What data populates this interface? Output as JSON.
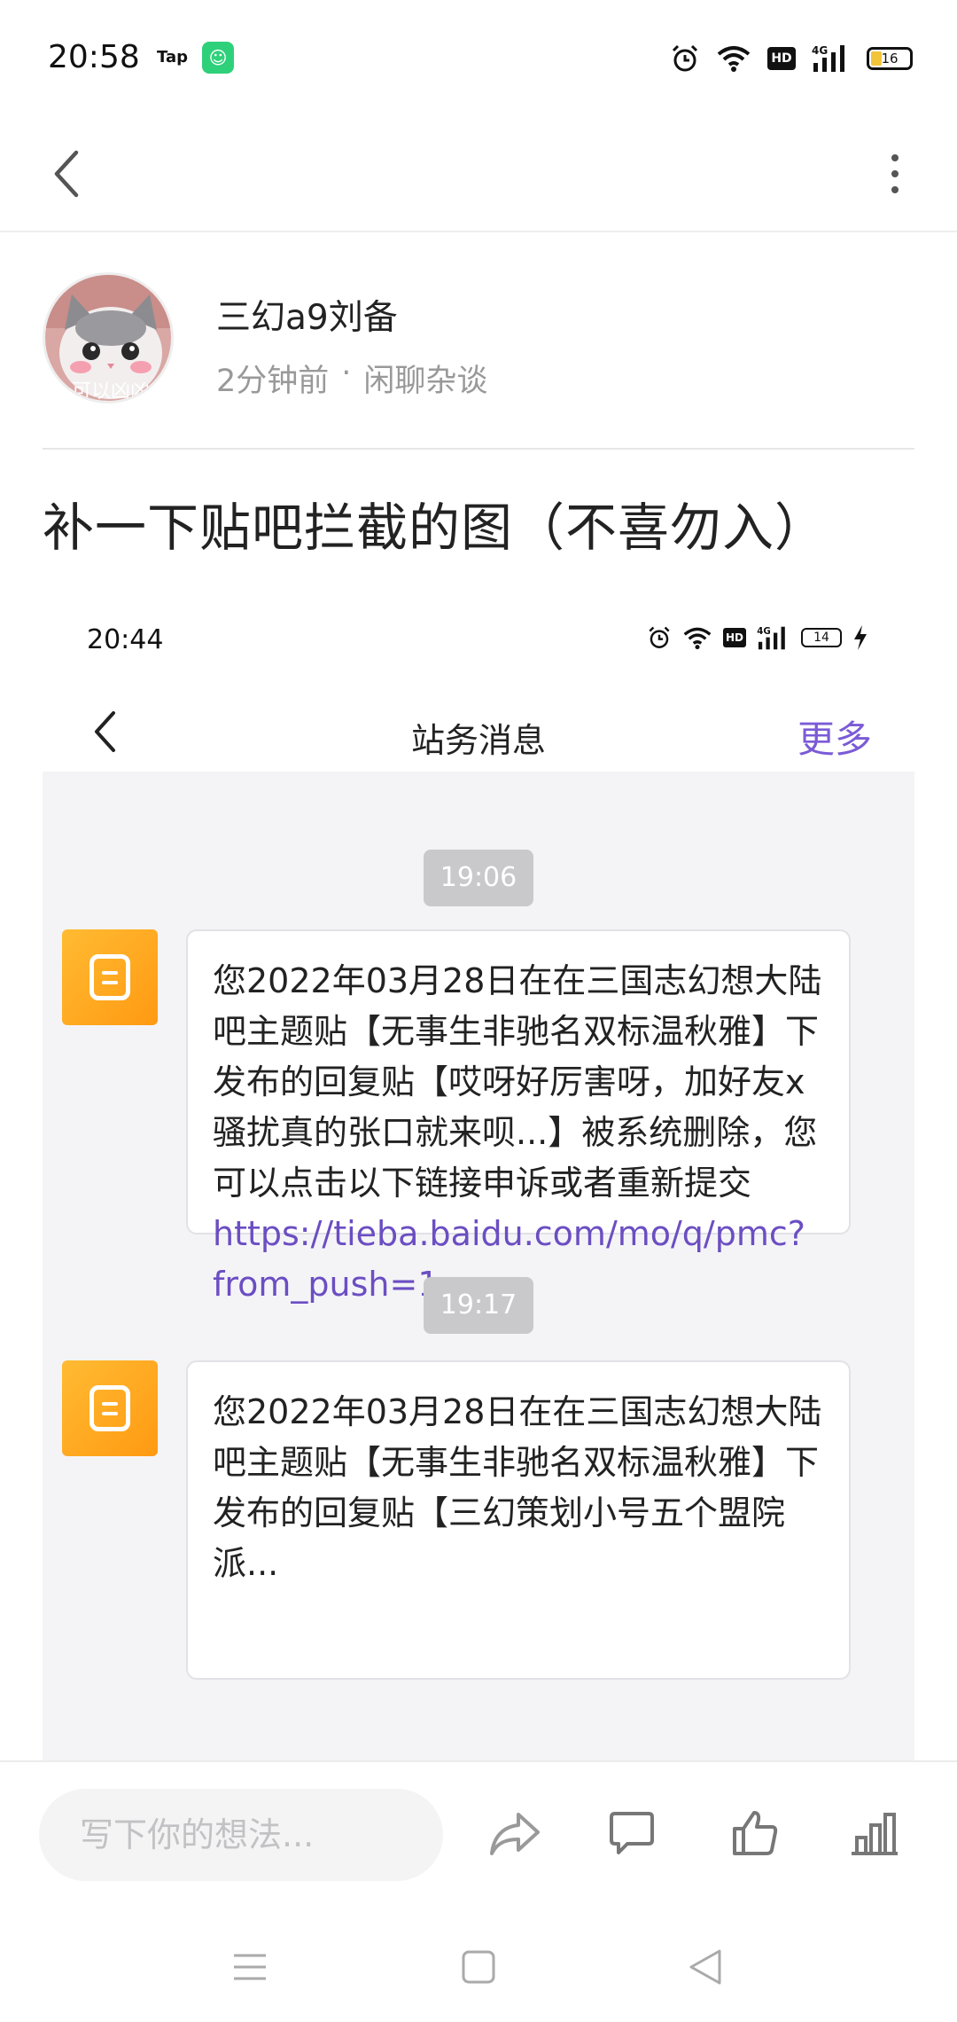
{
  "status_bar": {
    "time": "20:58",
    "tap_label": "Tap",
    "app_icon": "taptap-app-icon",
    "hd_label": "HD",
    "network": "4G",
    "battery": "16"
  },
  "top_nav": {
    "back_icon": "chevron-left-icon",
    "more_icon": "more-vertical-icon"
  },
  "author": {
    "name": "三幻a9刘备",
    "time_ago": "2分钟前",
    "separator": "·",
    "board": "闲聊杂谈",
    "avatar_caption": "可以凶凶"
  },
  "post": {
    "title": "补一下贴吧拦截的图（不喜勿入）"
  },
  "embedded_screenshot": {
    "time": "20:44",
    "hd_label": "HD",
    "network": "4G",
    "battery": "14",
    "nav_title": "站务消息",
    "more_label": "更多",
    "messages": [
      {
        "time": "19:06",
        "text": "您2022年03月28日在在三国志幻想大陆吧主题贴【无事生非驰名双标温秋雅】下发布的回复贴【哎呀好厉害呀，加好友x骚扰真的张口就来呗...】被系统删除，您可以点击以下链接申诉或者重新提交",
        "link": "https://tieba.baidu.com/mo/q/pmc?from_push=1",
        "suffix": " 。"
      },
      {
        "time": "19:17",
        "text": "您2022年03月28日在在三国志幻想大陆吧主题贴【无事生非驰名双标温秋雅】下发布的回复贴【三幻策划小号五个盟院派..."
      }
    ]
  },
  "action_bar": {
    "comment_placeholder": "写下你的想法...",
    "share_icon": "share-icon",
    "comment_icon": "comment-icon",
    "like_icon": "thumbs-up-icon",
    "stats_icon": "bar-chart-icon"
  },
  "system_nav": {
    "menu_icon": "menu-icon",
    "home_icon": "home-square-icon",
    "back_icon": "back-triangle-icon"
  }
}
